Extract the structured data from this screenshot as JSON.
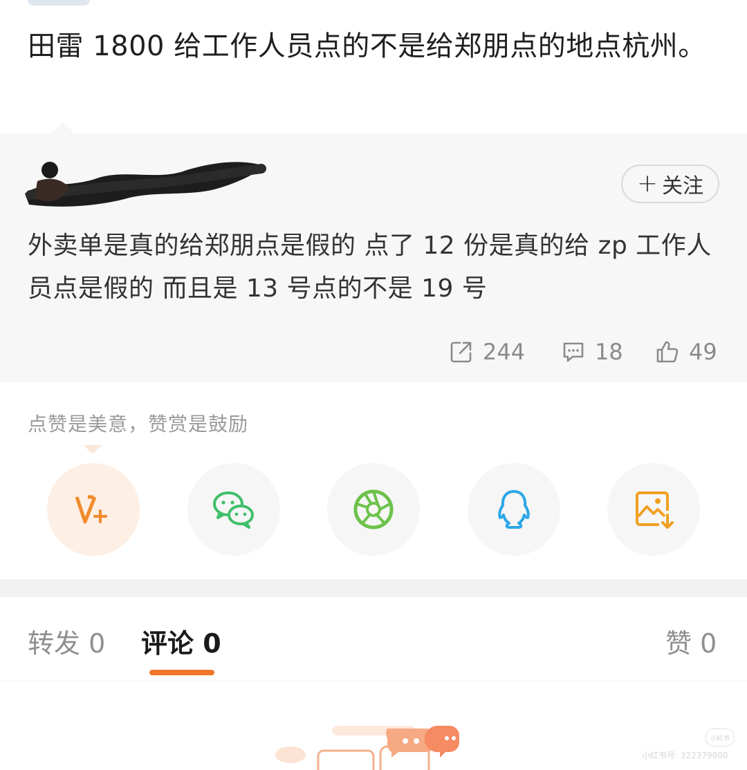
{
  "post": {
    "text": "田雷 1800 给工作人员点的不是给郑朋点的地点杭州。"
  },
  "quoted_comment": {
    "follow_label": "关注",
    "follow_plus": "+",
    "text": "外卖单是真的给郑朋点是假的 点了 12 份是真的给 zp 工作人员点是假的 而且是 13 号点的不是 19 号",
    "stats": {
      "reposts": "244",
      "comments": "18",
      "likes": "49"
    }
  },
  "tip": "点赞是美意，赞赏是鼓励",
  "share_icons": [
    "v-plus-icon",
    "wechat-icon",
    "moments-icon",
    "qq-icon",
    "save-image-icon"
  ],
  "tabs": {
    "repost": "转发 0",
    "comment": "评论 0",
    "like": "赞 0"
  },
  "colors": {
    "accent": "#f0762c",
    "wechat": "#3fbf6a",
    "moments": "#6cc24a",
    "qq": "#2aa7e8",
    "save": "#f0a020"
  },
  "watermark": {
    "logo": "小红书",
    "text": "小红书号: 322379800"
  }
}
